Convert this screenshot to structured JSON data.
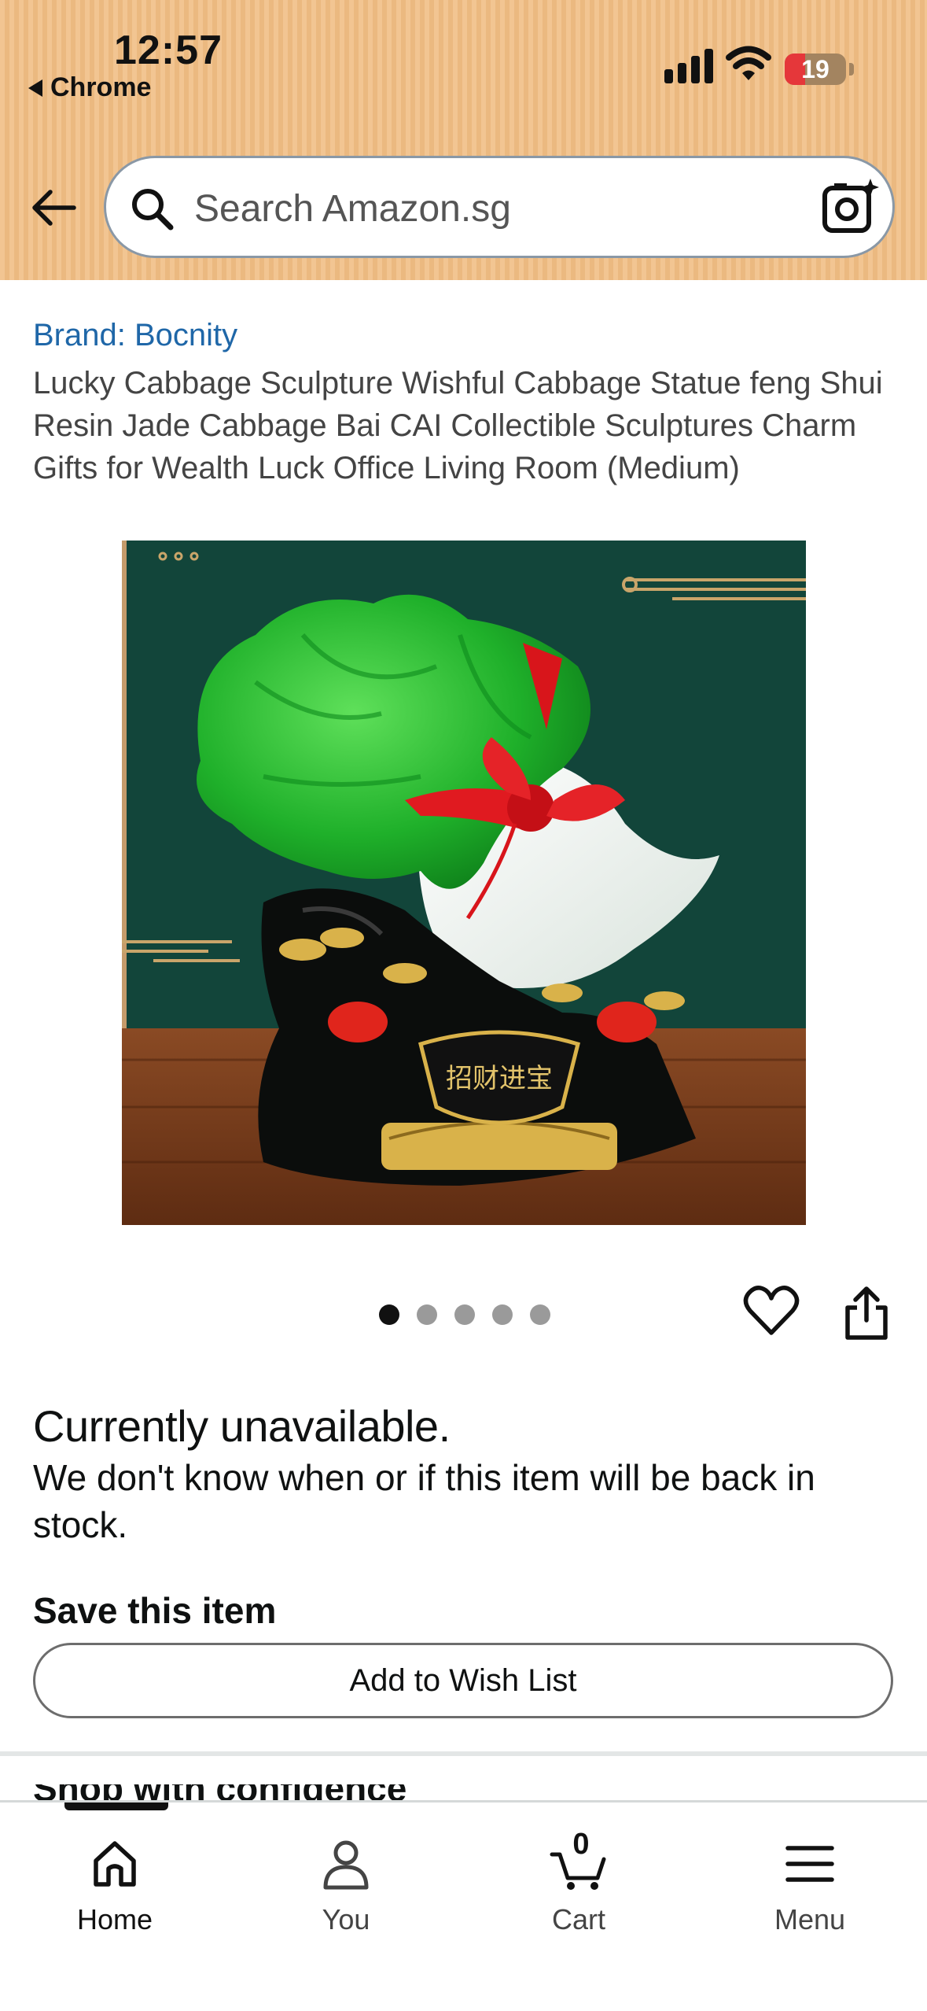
{
  "status_bar": {
    "time": "12:57",
    "back_app": "Chrome",
    "battery": "19",
    "battery_level": 0.19
  },
  "search": {
    "placeholder": "Search Amazon.sg"
  },
  "product": {
    "brand": "Brand: Bocnity",
    "title": "Lucky Cabbage Sculpture Wishful Cabbage Statue feng Shui Resin Jade Cabbage Bai CAI Collectible Sculptures Charm Gifts for Wealth Luck Office Living Room (Medium)",
    "image_caption": "招财进宝",
    "image_count": 5,
    "active_image": 1
  },
  "availability": {
    "heading": "Currently unavailable.",
    "description": "We don't know when or if this item will be back in stock."
  },
  "save": {
    "heading": "Save this item",
    "wish_list_label": "Add to Wish List",
    "next_section_peek": "Shop with confidence"
  },
  "bottom_nav": {
    "items": [
      {
        "label": "Home",
        "icon": "home-icon",
        "active": true
      },
      {
        "label": "You",
        "icon": "person-icon",
        "active": false
      },
      {
        "label": "Cart",
        "icon": "cart-icon",
        "active": false
      },
      {
        "label": "Menu",
        "icon": "menu-icon",
        "active": false
      }
    ],
    "cart_count": "0"
  },
  "colors": {
    "header_bg": "#f2c592",
    "link": "#1f67a8",
    "image_bg": "#12453a"
  }
}
